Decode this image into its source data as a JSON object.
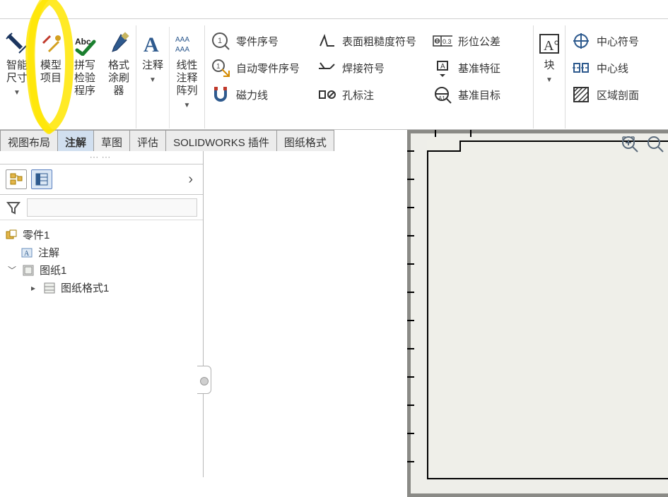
{
  "ribbon": {
    "smart_dim": {
      "l1": "智能",
      "l2": "尺寸"
    },
    "model_items": {
      "l1": "模型",
      "l2": "项目"
    },
    "spell": {
      "l1": "拼写",
      "l2": "检验",
      "l3": "程序"
    },
    "format": {
      "l1": "格式",
      "l2": "涂刷",
      "l3": "器"
    },
    "annotate": {
      "l1": "注释"
    },
    "linear_pat": {
      "l1": "线性",
      "l2": "注释",
      "l3": "阵列"
    },
    "balloon": "零件序号",
    "auto_balloon": "自动零件序号",
    "magnet_line": "磁力线",
    "surface_finish": "表面粗糙度符号",
    "weld_symbol": "焊接符号",
    "hole_callout": "孔标注",
    "geo_tol": "形位公差",
    "datum_feature": "基准特征",
    "datum_target": "基准目标",
    "block": {
      "l1": "块"
    },
    "center_mark": "中心符号",
    "centerline": "中心线",
    "area_hatch": "区域剖面"
  },
  "tabs": {
    "view_layout": "视图布局",
    "annotate_tab": "注解",
    "sketch": "草图",
    "evaluate": "评估",
    "sw_addins": "SOLIDWORKS 插件",
    "sheet_format": "图纸格式"
  },
  "tree": {
    "root": "零件1",
    "anno": "注解",
    "sheet": "图纸1",
    "sheetf": "图纸格式1"
  }
}
